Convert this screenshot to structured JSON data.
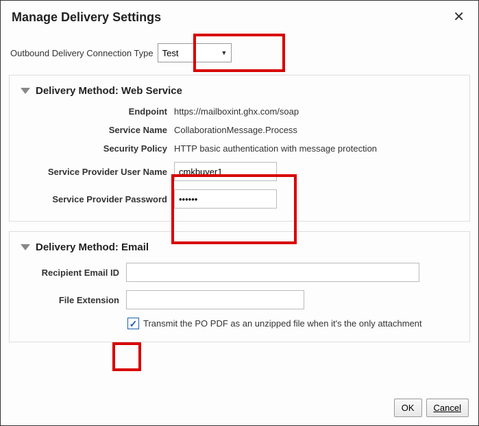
{
  "header": {
    "title": "Manage Delivery Settings"
  },
  "topRow": {
    "label": "Outbound Delivery Connection Type",
    "selected": "Test"
  },
  "webService": {
    "panelTitle": "Delivery Method: Web Service",
    "endpointLabel": "Endpoint",
    "endpointValue": "https://mailboxint.ghx.com/soap",
    "serviceNameLabel": "Service Name",
    "serviceNameValue": "CollaborationMessage.Process",
    "securityPolicyLabel": "Security Policy",
    "securityPolicyValue": "HTTP basic authentication with message protection",
    "userNameLabel": "Service Provider User Name",
    "userNameValue": "cmkbuyer1",
    "passwordLabel": "Service Provider Password",
    "passwordValue": "••••••"
  },
  "email": {
    "panelTitle": "Delivery Method: Email",
    "recipientLabel": "Recipient Email ID",
    "recipientValue": "",
    "extLabel": "File Extension",
    "extValue": "",
    "checkboxLabel": "Transmit the PO PDF as an unzipped file when it's the only attachment",
    "checkboxChecked": true
  },
  "footer": {
    "ok": "OK",
    "cancel": "Cancel"
  }
}
